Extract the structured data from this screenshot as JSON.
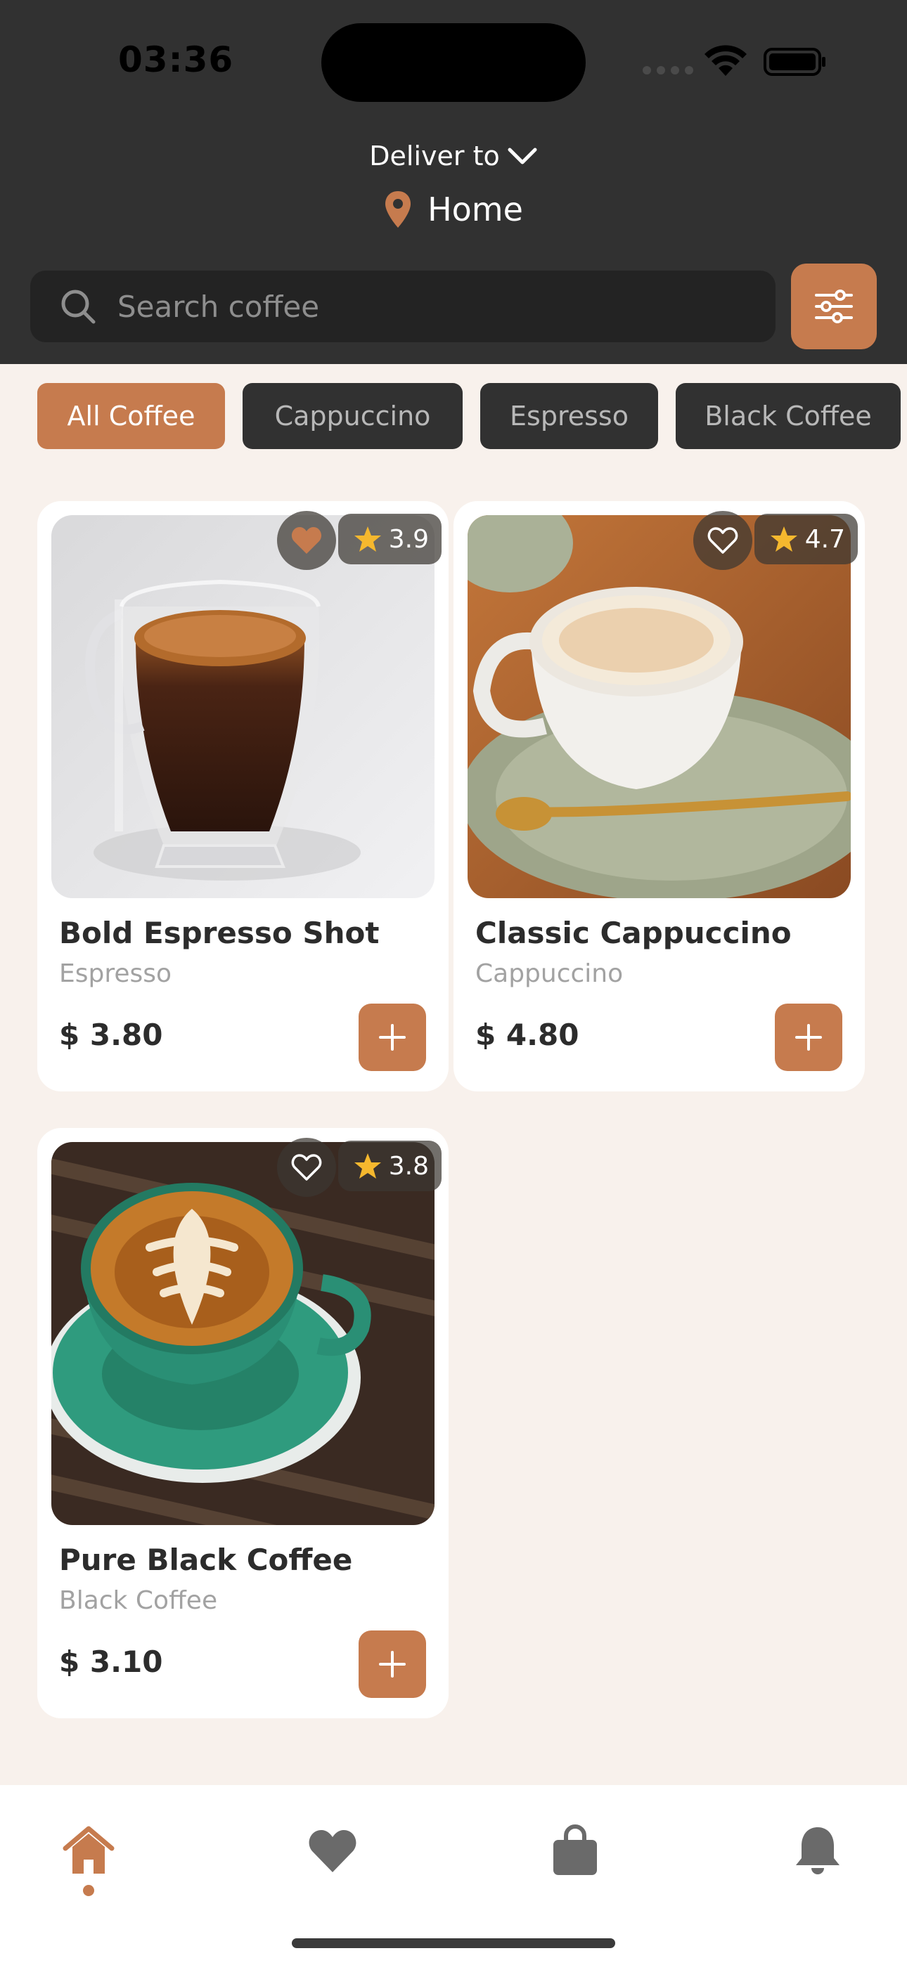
{
  "status_bar": {
    "time": "03:36"
  },
  "header": {
    "deliver_label": "Deliver to",
    "location": "Home",
    "search_placeholder": "Search coffee"
  },
  "categories": [
    "All Coffee",
    "Cappuccino",
    "Espresso",
    "Black Coffee"
  ],
  "active_category": "All Coffee",
  "products": [
    {
      "name": "Bold Espresso Shot",
      "category": "Espresso",
      "price": "$ 3.80",
      "rating": "3.9",
      "favorited": true
    },
    {
      "name": "Classic Cappuccino",
      "category": "Cappuccino",
      "price": "$ 4.80",
      "rating": "4.7",
      "favorited": false
    },
    {
      "name": "Pure Black Coffee",
      "category": "Black Coffee",
      "price": "$ 3.10",
      "rating": "3.8",
      "favorited": false
    }
  ],
  "bottom_nav": {
    "items": [
      "home-icon",
      "heart-icon",
      "bag-icon",
      "bell-icon"
    ],
    "active": "home-icon"
  },
  "colors": {
    "accent": "#c67b4e",
    "header_bg": "#313131",
    "page_bg": "#f8f1ec",
    "star": "#f5b82e"
  }
}
